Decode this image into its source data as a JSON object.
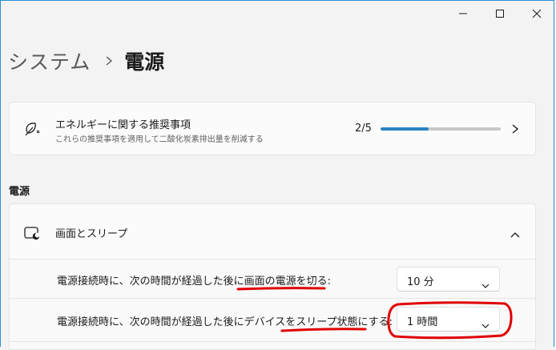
{
  "breadcrumb": {
    "parent": "システム",
    "current": "電源"
  },
  "recommendations": {
    "title": "エネルギーに関する推奨事項",
    "subtitle": "これらの推奨事項を適用して二酸化炭素排出量を削減する",
    "count": "2/5",
    "progress": 0.4
  },
  "section": {
    "label": "電源"
  },
  "screen_sleep": {
    "title": "画面とスリープ",
    "rows": [
      {
        "label": "電源接続時に、次の時間が経過した後に画面の電源を切る:",
        "value": "10 分"
      },
      {
        "label": "電源接続時に、次の時間が経過した後にデバイスをスリープ状態にする:",
        "value": "1 時間"
      }
    ]
  },
  "colors": {
    "accent": "#2a83c4",
    "annotation": "#e00000",
    "border": "#2a8fd6"
  }
}
